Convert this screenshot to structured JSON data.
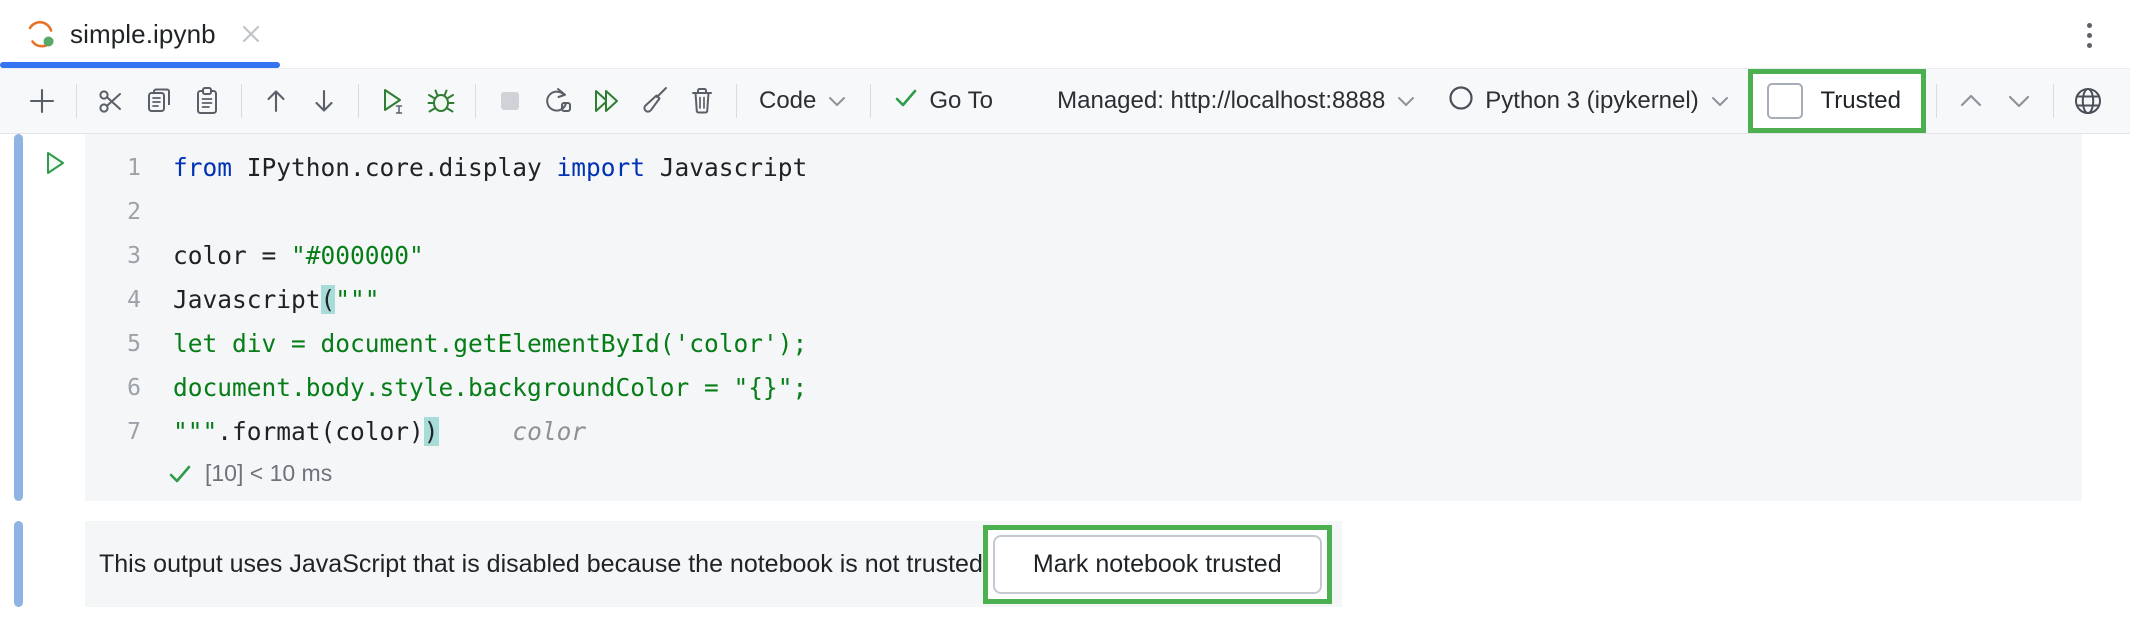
{
  "tab": {
    "title": "simple.ipynb",
    "icon": "jupyter-notebook-icon",
    "close_icon": "close-icon"
  },
  "window": {
    "more_menu_icon": "more-vertical-icon"
  },
  "toolbar": {
    "buttons": [
      {
        "name": "add-cell-button",
        "icon": "plus-icon"
      },
      {
        "name": "cut-cell-button",
        "icon": "scissors-icon"
      },
      {
        "name": "copy-cell-button",
        "icon": "copy-icon"
      },
      {
        "name": "paste-cell-button",
        "icon": "paste-icon"
      },
      {
        "name": "move-cell-up-button",
        "icon": "arrow-up-icon"
      },
      {
        "name": "move-cell-down-button",
        "icon": "arrow-down-icon"
      },
      {
        "name": "run-cell-button",
        "icon": "run-icon"
      },
      {
        "name": "debug-cell-button",
        "icon": "bug-icon"
      },
      {
        "name": "interrupt-kernel-button",
        "icon": "stop-icon"
      },
      {
        "name": "restart-kernel-button",
        "icon": "restart-icon"
      },
      {
        "name": "run-all-cells-button",
        "icon": "run-all-icon"
      },
      {
        "name": "clear-outputs-button",
        "icon": "broom-icon"
      },
      {
        "name": "delete-cell-button",
        "icon": "trash-icon"
      }
    ],
    "cell_type": "Code",
    "cell_type_chevron": "chevron-down-icon",
    "go_to": "Go To",
    "go_to_icon": "checkmark-icon",
    "server": "Managed: http://localhost:8888",
    "server_chevron": "chevron-down-icon",
    "kernel": "Python 3 (ipykernel)",
    "kernel_status_icon": "kernel-idle-circle-icon",
    "kernel_chevron": "chevron-down-icon",
    "trusted_label": "Trusted",
    "trusted_checked": false,
    "prev_cell_icon": "chevron-up-icon",
    "next_cell_icon": "chevron-down-icon",
    "browser_icon": "globe-icon"
  },
  "notebook": {
    "cell": {
      "run_icon": "run-cell-triangle-icon",
      "line_numbers": [
        "1",
        "2",
        "3",
        "4",
        "5",
        "6",
        "7"
      ],
      "lines": [
        [
          {
            "t": "from ",
            "c": "k"
          },
          {
            "t": "IPython.core.display ",
            "c": ""
          },
          {
            "t": "import ",
            "c": "k"
          },
          {
            "t": "Javascript",
            "c": ""
          }
        ],
        [],
        [
          {
            "t": "color = ",
            "c": ""
          },
          {
            "t": "\"#000000\"",
            "c": "s"
          }
        ],
        [
          {
            "t": "Javascript",
            "c": ""
          },
          {
            "t": "(",
            "c": "hl"
          },
          {
            "t": "\"\"\"",
            "c": "s"
          }
        ],
        [
          {
            "t": "let div = document.getElementById('color');",
            "c": "s"
          }
        ],
        [
          {
            "t": "document.body.style.backgroundColor = \"{}\";",
            "c": "s"
          }
        ],
        [
          {
            "t": "\"\"\"",
            "c": "s"
          },
          {
            "t": ".format(color)",
            "c": ""
          },
          {
            "t": ")",
            "c": "hl"
          },
          {
            "t": "     ",
            "c": ""
          },
          {
            "t": "color",
            "c": "hint"
          }
        ]
      ],
      "status_icon": "checkmark-icon",
      "status_text": "[10] < 10 ms"
    },
    "output": {
      "message": "This output uses JavaScript that is disabled because the notebook is not trusted",
      "button_label": "Mark notebook trusted"
    },
    "inspection_icon": "inspection-ok-checkmark-icon"
  },
  "colors": {
    "accent_blue": "#3574f0",
    "highlight_green": "#4caf50",
    "keyword_blue": "#0033b3",
    "string_green": "#067d17",
    "bracket_highlight": "#a8dcd8",
    "cell_bg": "#f5f6f8",
    "gutter_bar": "#8fb4e3"
  }
}
